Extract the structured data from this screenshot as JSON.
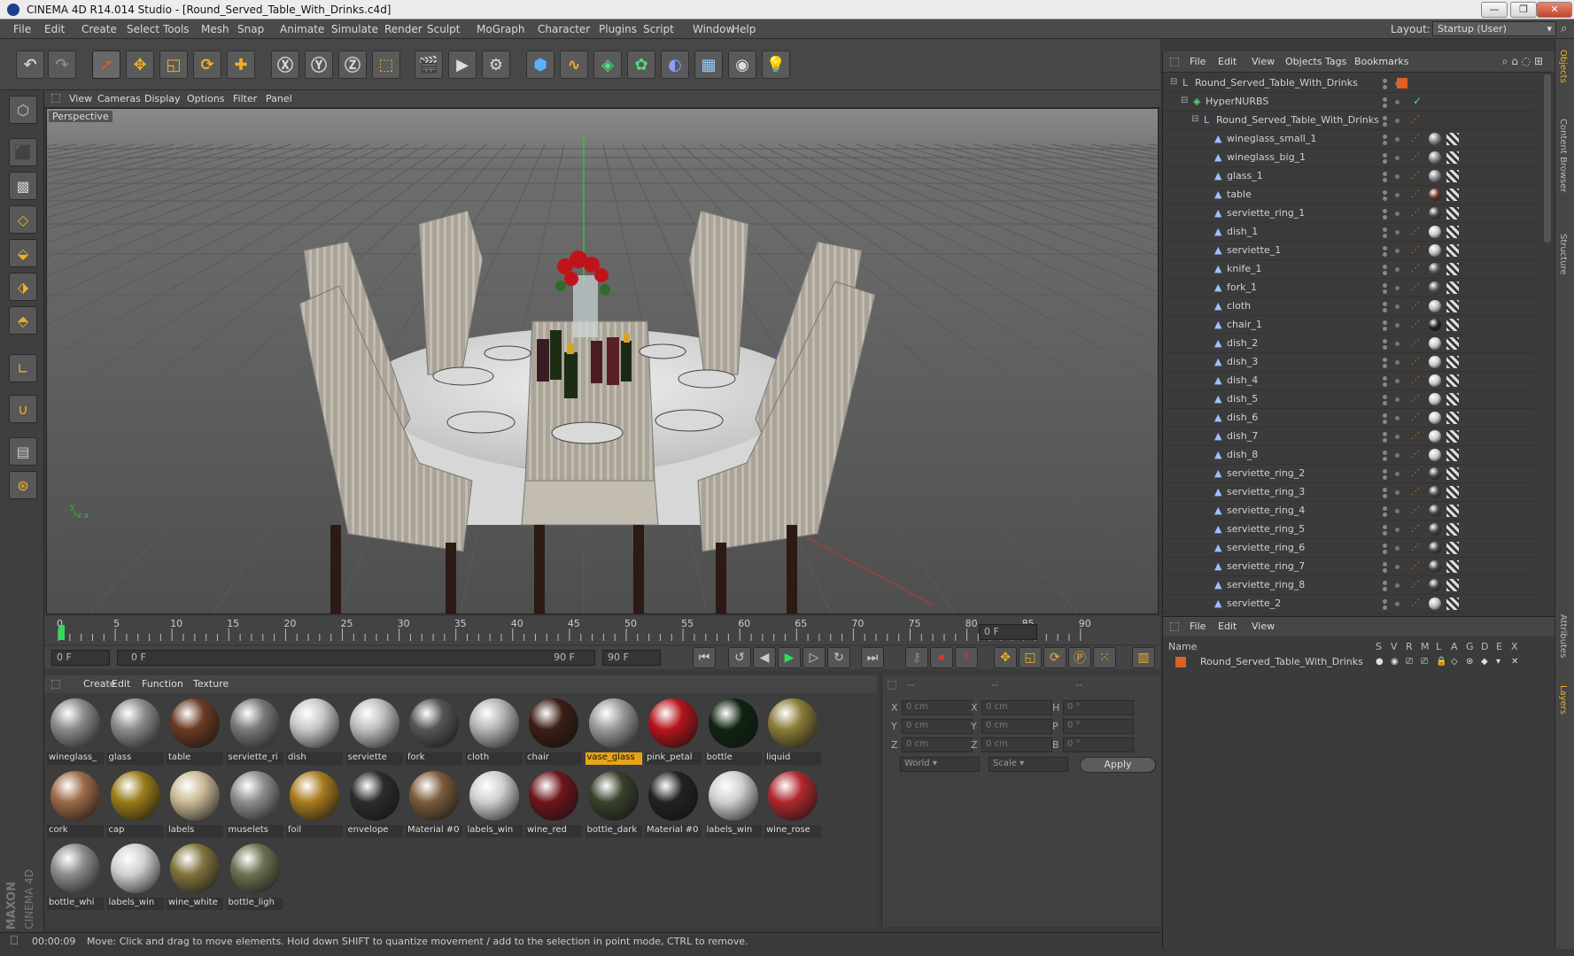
{
  "window": {
    "title": "CINEMA 4D R14.014 Studio - [Round_Served_Table_With_Drinks.c4d]",
    "min": "—",
    "max": "❐",
    "close": "✕"
  },
  "menubar": {
    "items": [
      "File",
      "Edit",
      "Create",
      "Select",
      "Tools",
      "Mesh",
      "Snap",
      "Animate",
      "Simulate",
      "Render",
      "Sculpt",
      "MoGraph",
      "Character",
      "Plugins",
      "Script",
      "Window",
      "Help"
    ],
    "layout_label": "Layout:",
    "layout_value": "Startup (User)"
  },
  "viewport": {
    "menu": [
      "View",
      "Cameras",
      "Display",
      "Options",
      "Filter",
      "Panel"
    ],
    "label": "Perspective"
  },
  "timeline": {
    "ticks": [
      "0",
      "5",
      "10",
      "15",
      "20",
      "25",
      "30",
      "35",
      "40",
      "45",
      "50",
      "55",
      "60",
      "65",
      "70",
      "75",
      "80",
      "85",
      "90"
    ],
    "current_frame": "0 F"
  },
  "transport": {
    "start": "0 F",
    "range_start": "0 F",
    "range_end": "90 F",
    "end": "90 F"
  },
  "materials": {
    "menu": [
      "Create",
      "Edit",
      "Function",
      "Texture"
    ],
    "items": [
      {
        "label": "wineglass_",
        "color": "#8a8a8a"
      },
      {
        "label": "glass",
        "color": "#8c8c8c"
      },
      {
        "label": "table",
        "color": "#6b3a22"
      },
      {
        "label": "serviette_ri",
        "color": "#7a7a7a"
      },
      {
        "label": "dish",
        "color": "#c8c8c8"
      },
      {
        "label": "serviette",
        "color": "#bfbfbf"
      },
      {
        "label": "fork",
        "color": "#555555"
      },
      {
        "label": "cloth",
        "color": "#b5b5b5"
      },
      {
        "label": "chair",
        "color": "#3a1e14"
      },
      {
        "label": "vase_glass",
        "color": "#9a9a9a"
      },
      {
        "label": "pink_petal",
        "color": "#b4141c"
      },
      {
        "label": "bottle",
        "color": "#0f2412"
      },
      {
        "label": "liquid",
        "color": "#8a7c38"
      },
      {
        "label": "cork",
        "color": "#9c6a45"
      },
      {
        "label": "cap",
        "color": "#9a7b1a"
      },
      {
        "label": "labels",
        "color": "#c9b995"
      },
      {
        "label": "muselets",
        "color": "#8d8d8d"
      },
      {
        "label": "foil",
        "color": "#a87b1e"
      },
      {
        "label": "envelope",
        "color": "#2c2c2c"
      },
      {
        "label": "Material #0",
        "color": "#7a5a3a"
      },
      {
        "label": "labels_win",
        "color": "#cfcfcf"
      },
      {
        "label": "wine_red",
        "color": "#6e141c"
      },
      {
        "label": "bottle_dark",
        "color": "#39402c"
      },
      {
        "label": "Material #0",
        "color": "#222222"
      },
      {
        "label": "labels_win",
        "color": "#cfcfcf"
      },
      {
        "label": "wine_rose",
        "color": "#b0282e"
      },
      {
        "label": "bottle_whi",
        "color": "#8c8c8c"
      },
      {
        "label": "labels_win",
        "color": "#d0d0d0"
      },
      {
        "label": "wine_white",
        "color": "#80733c"
      },
      {
        "label": "bottle_ligh",
        "color": "#6d7050"
      }
    ],
    "selected_index": 9,
    "selected_color": "#e8a316"
  },
  "coordinates": {
    "headers": [
      "--",
      "--",
      "--"
    ],
    "rows": [
      {
        "a": "X",
        "av": "0 cm",
        "b": "X",
        "bv": "0 cm",
        "c": "H",
        "cv": "0 °"
      },
      {
        "a": "Y",
        "av": "0 cm",
        "b": "Y",
        "bv": "0 cm",
        "c": "P",
        "cv": "0 °"
      },
      {
        "a": "Z",
        "av": "0 cm",
        "b": "Z",
        "bv": "0 cm",
        "c": "B",
        "cv": "0 °"
      }
    ],
    "world": "World",
    "scale": "Scale",
    "apply": "Apply"
  },
  "objects": {
    "menu": [
      "File",
      "Edit",
      "View",
      "Objects",
      "Tags",
      "Bookmarks"
    ],
    "rows": [
      {
        "name": "Round_Served_Table_With_Drinks",
        "level": 0,
        "kind": "null",
        "tag": "#e06020"
      },
      {
        "name": "HyperNURBS",
        "level": 1,
        "kind": "nurbs",
        "tag": "check"
      },
      {
        "name": "Round_Served_Table_With_Drinks",
        "level": 2,
        "kind": "null",
        "tag": ""
      },
      {
        "name": "wineglass_small_1",
        "level": 3,
        "kind": "poly",
        "tag": "#8a8a8a"
      },
      {
        "name": "wineglass_big_1",
        "level": 3,
        "kind": "poly",
        "tag": "#8a8a8a"
      },
      {
        "name": "glass_1",
        "level": 3,
        "kind": "poly",
        "tag": "#8a8a8a"
      },
      {
        "name": "table",
        "level": 3,
        "kind": "poly",
        "tag": "#6b3a22"
      },
      {
        "name": "serviette_ring_1",
        "level": 3,
        "kind": "poly",
        "tag": "#444444"
      },
      {
        "name": "dish_1",
        "level": 3,
        "kind": "poly",
        "tag": "#cccccc"
      },
      {
        "name": "serviette_1",
        "level": 3,
        "kind": "poly",
        "tag": "#bfbfbf"
      },
      {
        "name": "knife_1",
        "level": 3,
        "kind": "poly",
        "tag": "#555555"
      },
      {
        "name": "fork_1",
        "level": 3,
        "kind": "poly",
        "tag": "#555555"
      },
      {
        "name": "cloth",
        "level": 3,
        "kind": "poly",
        "tag": "#bbbbbb"
      },
      {
        "name": "chair_1",
        "level": 3,
        "kind": "poly",
        "tag": "#222222"
      },
      {
        "name": "dish_2",
        "level": 3,
        "kind": "poly",
        "tag": "#cccccc"
      },
      {
        "name": "dish_3",
        "level": 3,
        "kind": "poly",
        "tag": "#cccccc"
      },
      {
        "name": "dish_4",
        "level": 3,
        "kind": "poly",
        "tag": "#cccccc"
      },
      {
        "name": "dish_5",
        "level": 3,
        "kind": "poly",
        "tag": "#cccccc"
      },
      {
        "name": "dish_6",
        "level": 3,
        "kind": "poly",
        "tag": "#cccccc"
      },
      {
        "name": "dish_7",
        "level": 3,
        "kind": "poly",
        "tag": "#cccccc"
      },
      {
        "name": "dish_8",
        "level": 3,
        "kind": "poly",
        "tag": "#cccccc"
      },
      {
        "name": "serviette_ring_2",
        "level": 3,
        "kind": "poly",
        "tag": "#444444"
      },
      {
        "name": "serviette_ring_3",
        "level": 3,
        "kind": "poly",
        "tag": "#444444"
      },
      {
        "name": "serviette_ring_4",
        "level": 3,
        "kind": "poly",
        "tag": "#444444"
      },
      {
        "name": "serviette_ring_5",
        "level": 3,
        "kind": "poly",
        "tag": "#444444"
      },
      {
        "name": "serviette_ring_6",
        "level": 3,
        "kind": "poly",
        "tag": "#444444"
      },
      {
        "name": "serviette_ring_7",
        "level": 3,
        "kind": "poly",
        "tag": "#444444"
      },
      {
        "name": "serviette_ring_8",
        "level": 3,
        "kind": "poly",
        "tag": "#444444"
      },
      {
        "name": "serviette_2",
        "level": 3,
        "kind": "poly",
        "tag": "#bfbfbf"
      }
    ]
  },
  "layers": {
    "menu": [
      "File",
      "Edit",
      "View"
    ],
    "header_name": "Name",
    "header_cols": [
      "S",
      "V",
      "R",
      "M",
      "L",
      "A",
      "G",
      "D",
      "E",
      "X"
    ],
    "row": "Round_Served_Table_With_Drinks",
    "row_color": "#e06020"
  },
  "side_tabs": [
    "Objects",
    "Content Browser",
    "Structure",
    "Attributes",
    "Layers"
  ],
  "status": {
    "time": "00:00:09",
    "message": "Move: Click and drag to move elements. Hold down SHIFT to quantize movement / add to the selection in point mode, CTRL to remove."
  },
  "logo": {
    "maxon": "MAXON",
    "product": "CINEMA 4D"
  }
}
